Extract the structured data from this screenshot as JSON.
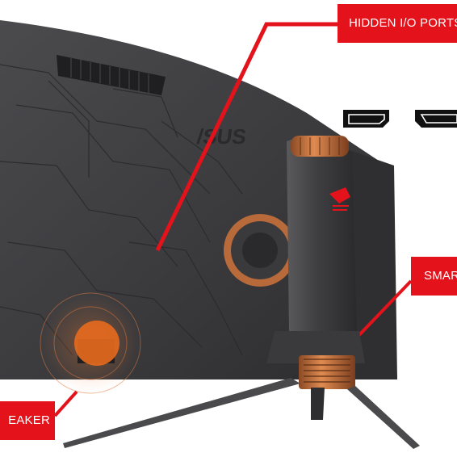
{
  "callouts": {
    "hidden_io_ports": "HIDDEN I/O PORTS",
    "smart": "SMAR",
    "speaker": "EAKER"
  },
  "logos": {
    "brand": "/SUS"
  },
  "icons": [
    "displayport-icon",
    "hdmi-icon"
  ],
  "colors": {
    "callout_red": "#e4121b",
    "monitor_body": "#3a3a3c",
    "copper_accent": "#c9743e",
    "background": "#ffffff"
  }
}
